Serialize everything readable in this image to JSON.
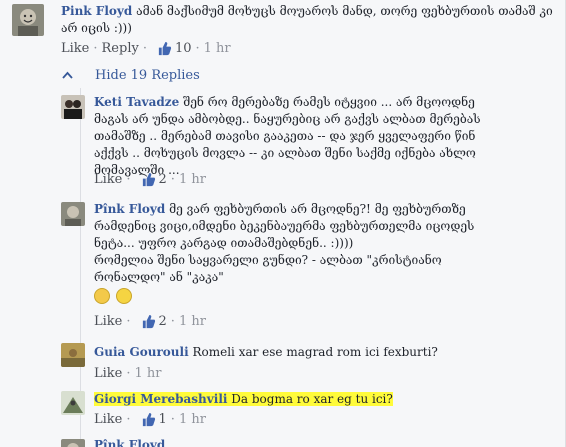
{
  "comments": [
    {
      "author": "Pink Floyd",
      "text": "ამან მაქსიმუმ მოხუცს მოუაროს მანდ, თორე ფეხბურთის თამაშ კი არ იცის :)))",
      "like": "Like",
      "reply": "Reply",
      "likes": "10",
      "time": "1 hr"
    },
    {
      "author": "Keti Tavadze",
      "text": "შენ რო მერებაზე რამეს იტყვიი ... არ მცოოდნე მაგას არ უნდა ამბობდე.. ნაყურებიც არ გაქვს ალბათ მერებას თამაშზე .. მერებამ თავისი გააკეთა -- და ჯერ ყველაფერი წინ აქქვს .. მოხუცის მოვლა -- კი ალბათ შენი საქმე იქნება ახლო მომავალში ...",
      "like": "Like",
      "likes": "2",
      "time": "1 hr"
    },
    {
      "author": "Pînk Floyd",
      "text": "მე ვარ ფეხბურთის არ მცოდნე?! მე ფეხბურთზე რამდენიც ვიცი,იმდენი ბეკენბაუერმა ფეხბურთელმა იცოდეს ნეტა... უფრო კარგად ითამაშებდნენ.. :))))",
      "text2": "რომელია შენი საყვარელი გუნდი? - ალბათ \"კრისტიანო რონალდო\" ან \"კაკა\"",
      "like": "Like",
      "likes": "2",
      "time": "1 hr"
    },
    {
      "author": "Guia Gourouli",
      "text": "Romeli xar ese magrad rom ici fexburti?",
      "like": "Like",
      "time": "1 hr"
    },
    {
      "author": "Giorgi Merebashvili",
      "text": "Da bogma ro xar eg tu ici?",
      "like": "Like",
      "likes": "1",
      "time": "1 hr"
    },
    {
      "author": "Pînk Floyd"
    }
  ],
  "hide_replies": "Hide 19 Replies",
  "colors": {
    "link": "#365899",
    "highlight": "#fffb3a",
    "like_blue": "#4267b2"
  }
}
